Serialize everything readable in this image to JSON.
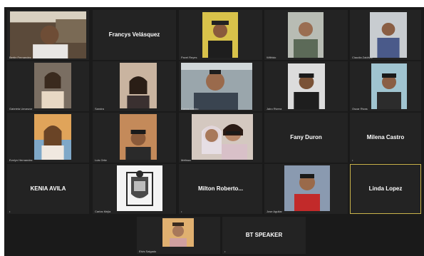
{
  "app": {
    "view": "Gallery View"
  },
  "participants": [
    {
      "id": "p1",
      "display_name": "",
      "label": "Bertin Fernandez",
      "video": true
    },
    {
      "id": "p2",
      "display_name": "Francys Velásquez",
      "label": "",
      "video": false
    },
    {
      "id": "p3",
      "display_name": "",
      "label": "Pavel Reyes",
      "video": true
    },
    {
      "id": "p4",
      "display_name": "",
      "label": "Wilfrido",
      "video": true
    },
    {
      "id": "p5",
      "display_name": "",
      "label": "Claudia Zaldivar",
      "video": true
    },
    {
      "id": "p6",
      "display_name": "",
      "label": "Gabriela Umanzor",
      "video": true
    },
    {
      "id": "p7",
      "display_name": "",
      "label": "Sandra",
      "video": true
    },
    {
      "id": "p8",
      "display_name": "",
      "label": "Carlos Castro",
      "video": true
    },
    {
      "id": "p9",
      "display_name": "",
      "label": "Jairo Rivera",
      "video": true
    },
    {
      "id": "p10",
      "display_name": "",
      "label": "Oscar Rivas",
      "video": true
    },
    {
      "id": "p11",
      "display_name": "",
      "label": "Evelyn Hernandez",
      "video": true
    },
    {
      "id": "p12",
      "display_name": "",
      "label": "Luis Ortiz",
      "video": true
    },
    {
      "id": "p13",
      "display_name": "",
      "label": "Melissa",
      "video": true
    },
    {
      "id": "p14",
      "display_name": "Fany Duron",
      "label": "",
      "video": false
    },
    {
      "id": "p15",
      "display_name": "Milena Castro",
      "label": "",
      "video": false
    },
    {
      "id": "p16",
      "display_name": "KENIA AVILA",
      "label": "",
      "video": false
    },
    {
      "id": "p17",
      "display_name": "",
      "label": "Carlos Mejia",
      "video": true
    },
    {
      "id": "p18",
      "display_name": "Milton Roberto...",
      "label": "",
      "video": false
    },
    {
      "id": "p19",
      "display_name": "",
      "label": "Jose Aguilar",
      "video": true
    },
    {
      "id": "p20",
      "display_name": "Linda Lopez",
      "label": "",
      "video": false,
      "active_speaker": true
    },
    {
      "id": "p21",
      "display_name": "",
      "label": "Elvis Salgado",
      "video": true
    },
    {
      "id": "p22",
      "display_name": "BT SPEAKER",
      "label": "",
      "video": false
    }
  ],
  "colors": {
    "background": "#1a1a1a",
    "tile": "#232323",
    "active_speaker_border": "#c9b24a"
  }
}
